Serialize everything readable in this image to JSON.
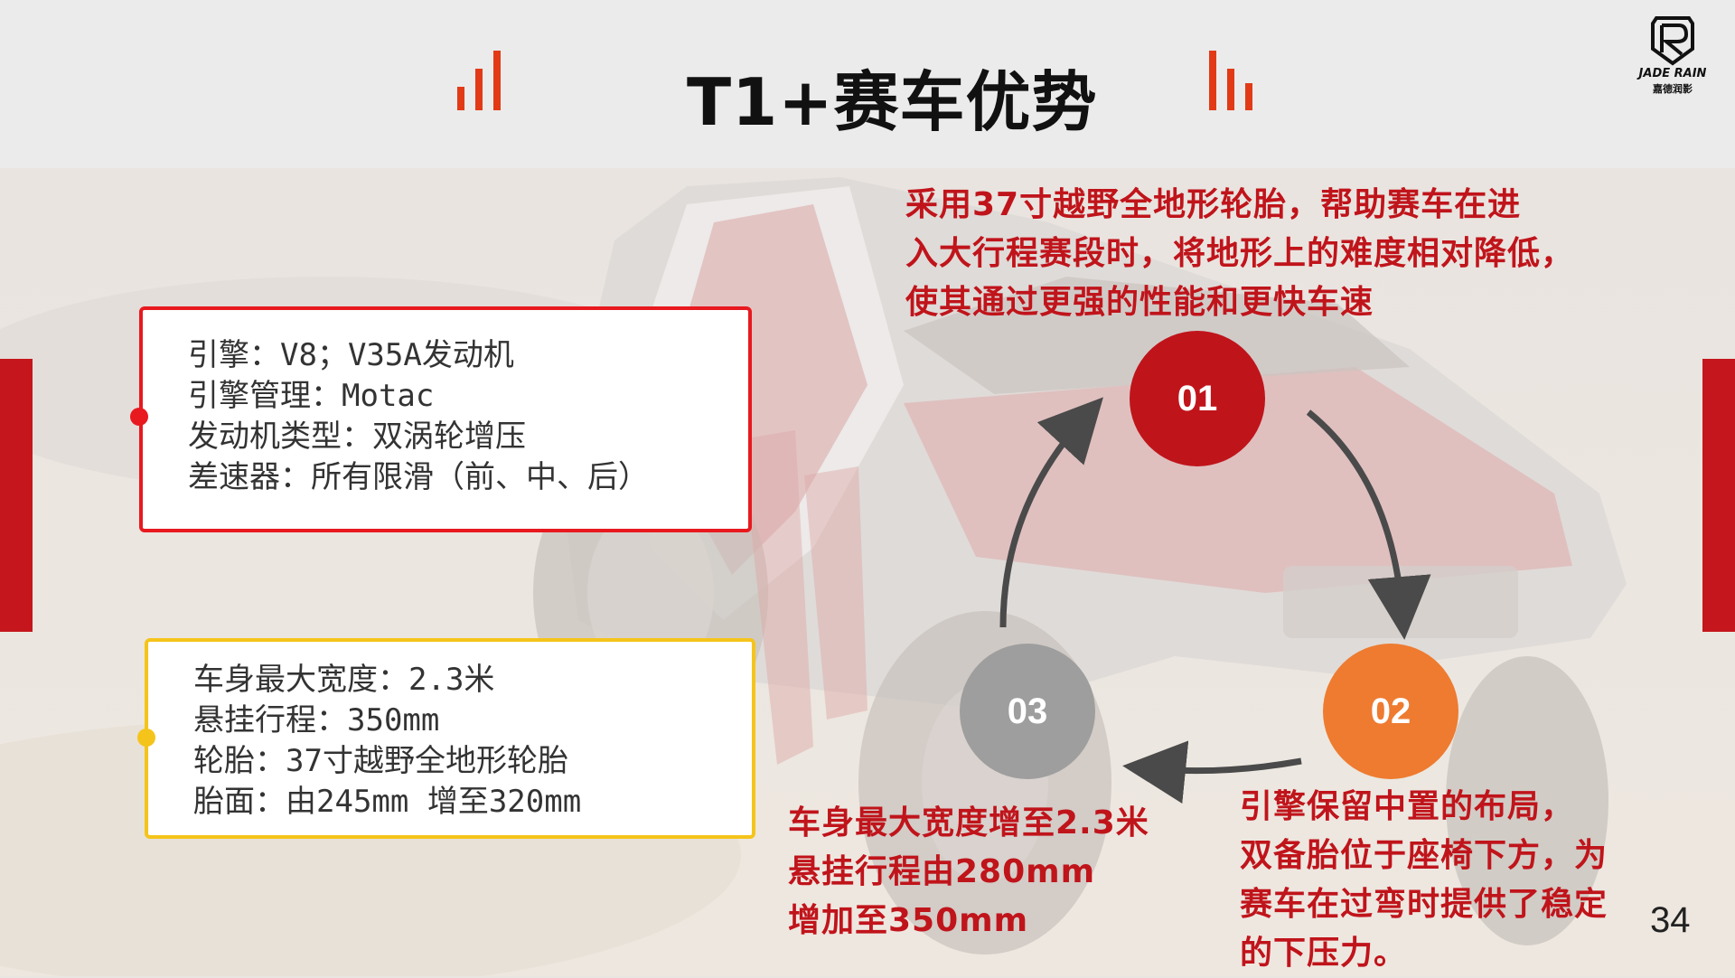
{
  "header": {
    "title": "T1+赛车优势"
  },
  "logo": {
    "brand": "JADE RAIN",
    "sub": "嘉德润影"
  },
  "spec_box_1": {
    "lines": [
      "引擎：V8；V35A发动机",
      "引擎管理：Motac",
      "发动机类型：双涡轮增压",
      "差速器：所有限滑（前、中、后）"
    ],
    "border_color": "#e8191f"
  },
  "spec_box_2": {
    "lines": [
      "车身最大宽度：2.3米",
      "悬挂行程：350mm",
      "轮胎：37寸越野全地形轮胎",
      "胎面：由245mm 增至320mm"
    ],
    "border_color": "#f5c41a"
  },
  "cycle": {
    "steps": [
      {
        "label": "01",
        "color": "#c0141b"
      },
      {
        "label": "02",
        "color": "#ee7b30"
      },
      {
        "label": "03",
        "color": "#9e9e9e"
      }
    ],
    "captions": {
      "top": [
        "采用37寸越野全地形轮胎，帮助赛车在进",
        "入大行程赛段时，将地形上的难度相对降低，",
        "使其通过更强的性能和更快车速"
      ],
      "bottom_right": [
        "引擎保留中置的布局，",
        "双备胎位于座椅下方，为",
        "赛车在过弯时提供了稳定",
        "的下压力。"
      ],
      "bottom_left": [
        "车身最大宽度增至2.3米",
        "悬挂行程由280mm",
        "增加至350mm"
      ]
    }
  },
  "page_number": "34",
  "colors": {
    "accent_red": "#c4161c",
    "bar_red": "#e23a16"
  }
}
